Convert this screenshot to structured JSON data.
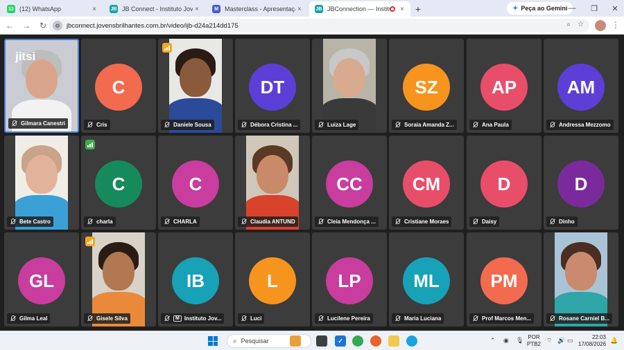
{
  "browser": {
    "tabs": [
      {
        "title": "(12) WhatsApp",
        "icon_badge": "12",
        "icon_color": "#25d366",
        "active": false
      },
      {
        "title": "JB Connect - Instituto Jovens Bri",
        "icon_badge": "JB",
        "icon_color": "#1aa3a3",
        "active": false
      },
      {
        "title": "Masterclass - Apresentação",
        "icon_badge": "M",
        "icon_color": "#4b5bd6",
        "active": false
      },
      {
        "title": "JBConnection — Instituto Jo",
        "icon_badge": "JB",
        "icon_color": "#1aa3a3",
        "active": true
      }
    ],
    "new_tab": "+",
    "gemini_label": "Peça ao Gemini",
    "url": "jbconnect.jovensbrilhantes.com.br/video/ijb-d24a214dd175",
    "window_controls": {
      "minimize": "—",
      "maximize": "❐",
      "close": "✕"
    }
  },
  "meeting": {
    "logo": "jitsi",
    "participants": [
      {
        "name": "Gilmara Canestri",
        "kind": "video",
        "self": true,
        "skin": "#d9a58a",
        "hair": "#bdbdbd",
        "shirt": "#f2f2f2",
        "bg": "#c9cdd3"
      },
      {
        "name": "Cris",
        "initials": "C",
        "color": "#f26b4e"
      },
      {
        "name": "Daniele Sousa",
        "kind": "video",
        "signal": "#f5a623",
        "skin": "#8a5a3c",
        "hair": "#2a1c14",
        "shirt": "#2b4a9a",
        "bg": "#e8e8e6"
      },
      {
        "name": "Débora Cristina ...",
        "initials": "DT",
        "color": "#5b3fd6"
      },
      {
        "name": "Luiza Lage",
        "kind": "video",
        "skin": "#d8aa90",
        "hair": "#c8c8c8",
        "shirt": "#3a3a3a",
        "bg": "#b9b4a8"
      },
      {
        "name": "Soraia Amanda Z...",
        "initials": "SZ",
        "color": "#f7941d"
      },
      {
        "name": "Ana Paula",
        "initials": "AP",
        "color": "#e84e6a"
      },
      {
        "name": "Andressa Mezzomo",
        "initials": "AM",
        "color": "#5b3fd6"
      },
      {
        "name": "Bete Castro",
        "kind": "video",
        "skin": "#e2b39a",
        "hair": "#c9a38a",
        "shirt": "#3aa0d6",
        "bg": "#f0ede7"
      },
      {
        "name": "charla",
        "initials": "C",
        "color": "#168a5a",
        "signal": "#3fae4a"
      },
      {
        "name": "CHARLA",
        "initials": "C",
        "color": "#c83d9e"
      },
      {
        "name": "Claudia ANTUND",
        "kind": "video",
        "skin": "#c88a68",
        "hair": "#5a3a22",
        "shirt": "#d9432b",
        "bg": "#cfc7ba"
      },
      {
        "name": "Cleia Mendonça ...",
        "initials": "CC",
        "color": "#c83d9e"
      },
      {
        "name": "Cristiane Moraes",
        "initials": "CM",
        "color": "#e84e6a"
      },
      {
        "name": "Daisy",
        "initials": "D",
        "color": "#e84e6a"
      },
      {
        "name": "Dinho",
        "initials": "D",
        "color": "#7b2a9c"
      },
      {
        "name": "Gilma Leal",
        "initials": "GL",
        "color": "#c83d9e"
      },
      {
        "name": "Gisele Silva",
        "kind": "video",
        "signal": "#f5a623",
        "skin": "#b07850",
        "hair": "#2a1c14",
        "shirt": "#e98a3a",
        "bg": "#d8d2c8"
      },
      {
        "name": "Instituto Jov...",
        "initials": "IB",
        "color": "#17a2b8",
        "moderator": "M"
      },
      {
        "name": "Luci",
        "initials": "L",
        "color": "#f7941d"
      },
      {
        "name": "Lucilene Pereira",
        "initials": "LP",
        "color": "#c83d9e"
      },
      {
        "name": "Maria Luciana",
        "initials": "ML",
        "color": "#17a2b8"
      },
      {
        "name": "Prof Marcos Men...",
        "initials": "PM",
        "color": "#f26b4e"
      },
      {
        "name": "Rosane Carniel B...",
        "kind": "video",
        "skin": "#c98a70",
        "hair": "#4a2e22",
        "shirt": "#2fa5a8",
        "bg": "#a9c4d6"
      }
    ]
  },
  "taskbar": {
    "search_placeholder": "Pesquisar",
    "language": "POR",
    "keyboard": "PTB2",
    "time": "22:03",
    "date": "17/08/2026"
  }
}
